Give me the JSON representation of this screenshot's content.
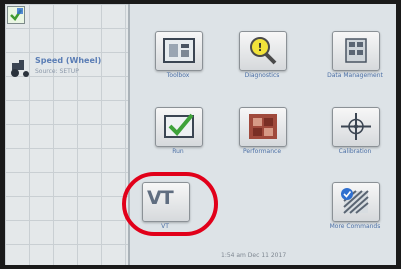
{
  "left_panel": {
    "speed_title": "Speed (Wheel)",
    "speed_subtitle": "Source: SETUP"
  },
  "tiles": {
    "toolbox": {
      "label": "Toolbox",
      "icon": "toolbox-icon"
    },
    "diagnostics": {
      "label": "Diagnostics",
      "icon": "magnifier-warning-icon"
    },
    "data_management": {
      "label": "Data Management",
      "icon": "data-management-icon"
    },
    "run": {
      "label": "Run",
      "icon": "run-checkmark-icon"
    },
    "performance": {
      "label": "Performance",
      "icon": "performance-icon"
    },
    "calibration": {
      "label": "Calibration",
      "icon": "crosshair-icon"
    },
    "vt": {
      "label": "VT",
      "icon_text": "VT"
    },
    "more_commands": {
      "label": "More Commands",
      "icon": "more-commands-icon"
    }
  },
  "status": {
    "datetime": "1:54 am    Dec 11 2017"
  },
  "colors": {
    "highlight_ring": "#e1001a",
    "label_blue": "#4b6fa5"
  }
}
